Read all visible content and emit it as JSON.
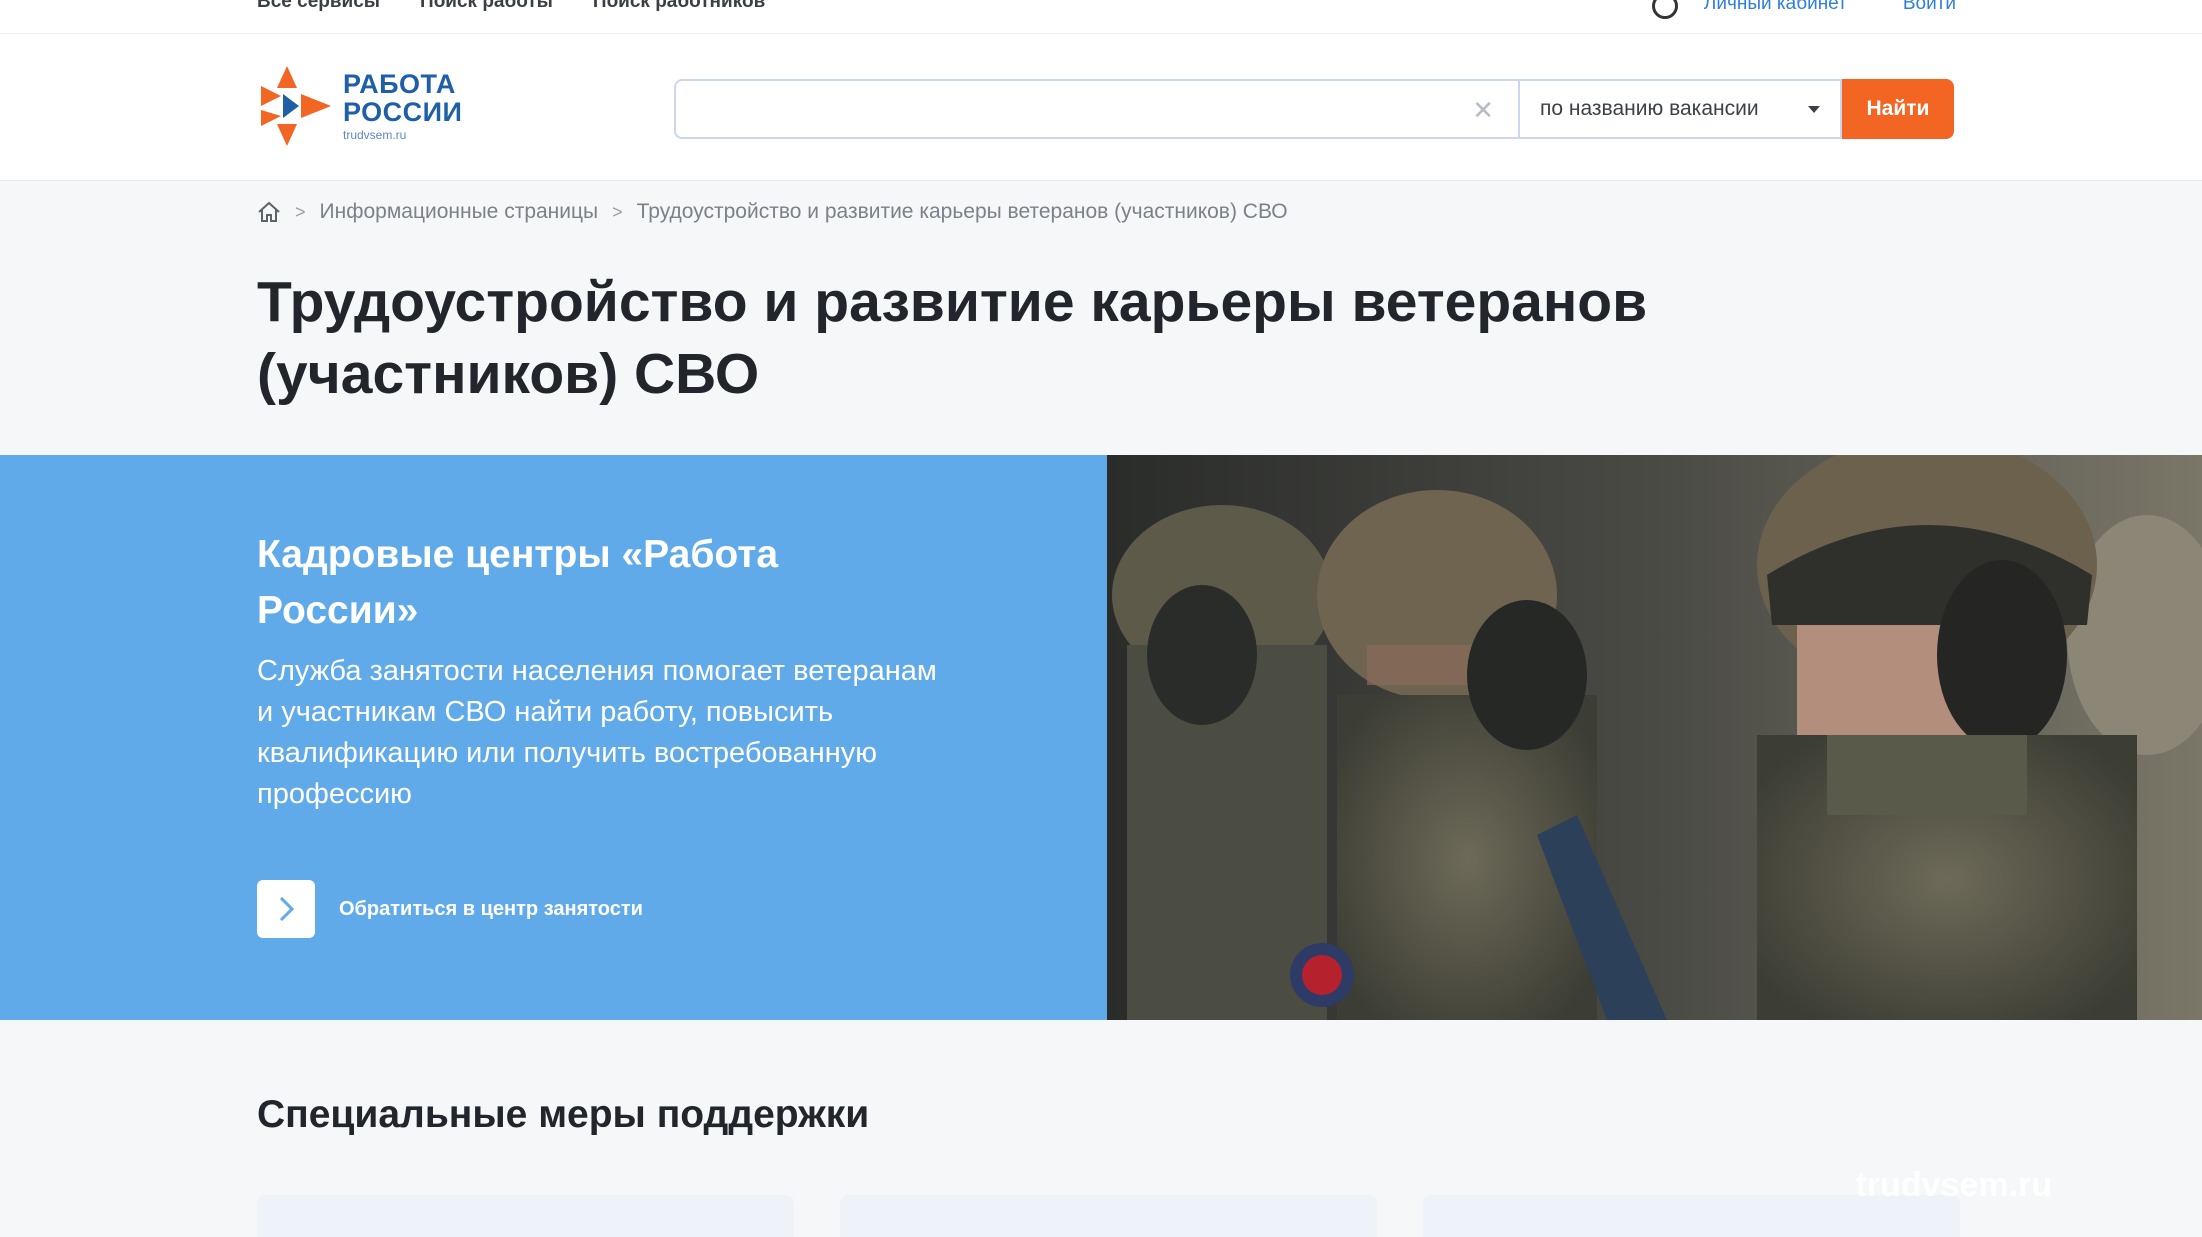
{
  "topbar": {
    "links": [
      "Все сервисы",
      "Поиск работы",
      "Поиск работников"
    ],
    "cabinet": "Личный кабинет",
    "login": "Войти"
  },
  "header": {
    "logo_line1": "РАБОТА",
    "logo_line2": "РОССИИ",
    "logo_url": "trudvsem.ru",
    "search_placeholder": "",
    "search_mode": "по названию вакансии",
    "search_button": "Найти"
  },
  "breadcrumb": {
    "items": [
      "Информационные страницы",
      "Трудоустройство и развитие карьеры ветеранов (участников) СВО"
    ]
  },
  "page": {
    "title_line1": "Трудоустройство и развитие карьеры ветеранов",
    "title_line2": "(участников) СВО"
  },
  "banner": {
    "title_line1": "Кадровые центры «Работа",
    "title_line2": "России»",
    "text_line1": "Служба занятости населения помогает ветеранам",
    "text_line2": "и участникам СВО найти работу, повысить",
    "text_line3": "квалификацию или получить востребованную",
    "text_line4": "профессию",
    "cta": "Обратиться в центр занятости"
  },
  "support": {
    "title": "Специальные меры поддержки"
  },
  "watermark": "trudvsem.ru",
  "colors": {
    "brand_orange": "#f26522",
    "brand_blue": "#1f5fa8",
    "banner_blue": "#61aaea"
  }
}
